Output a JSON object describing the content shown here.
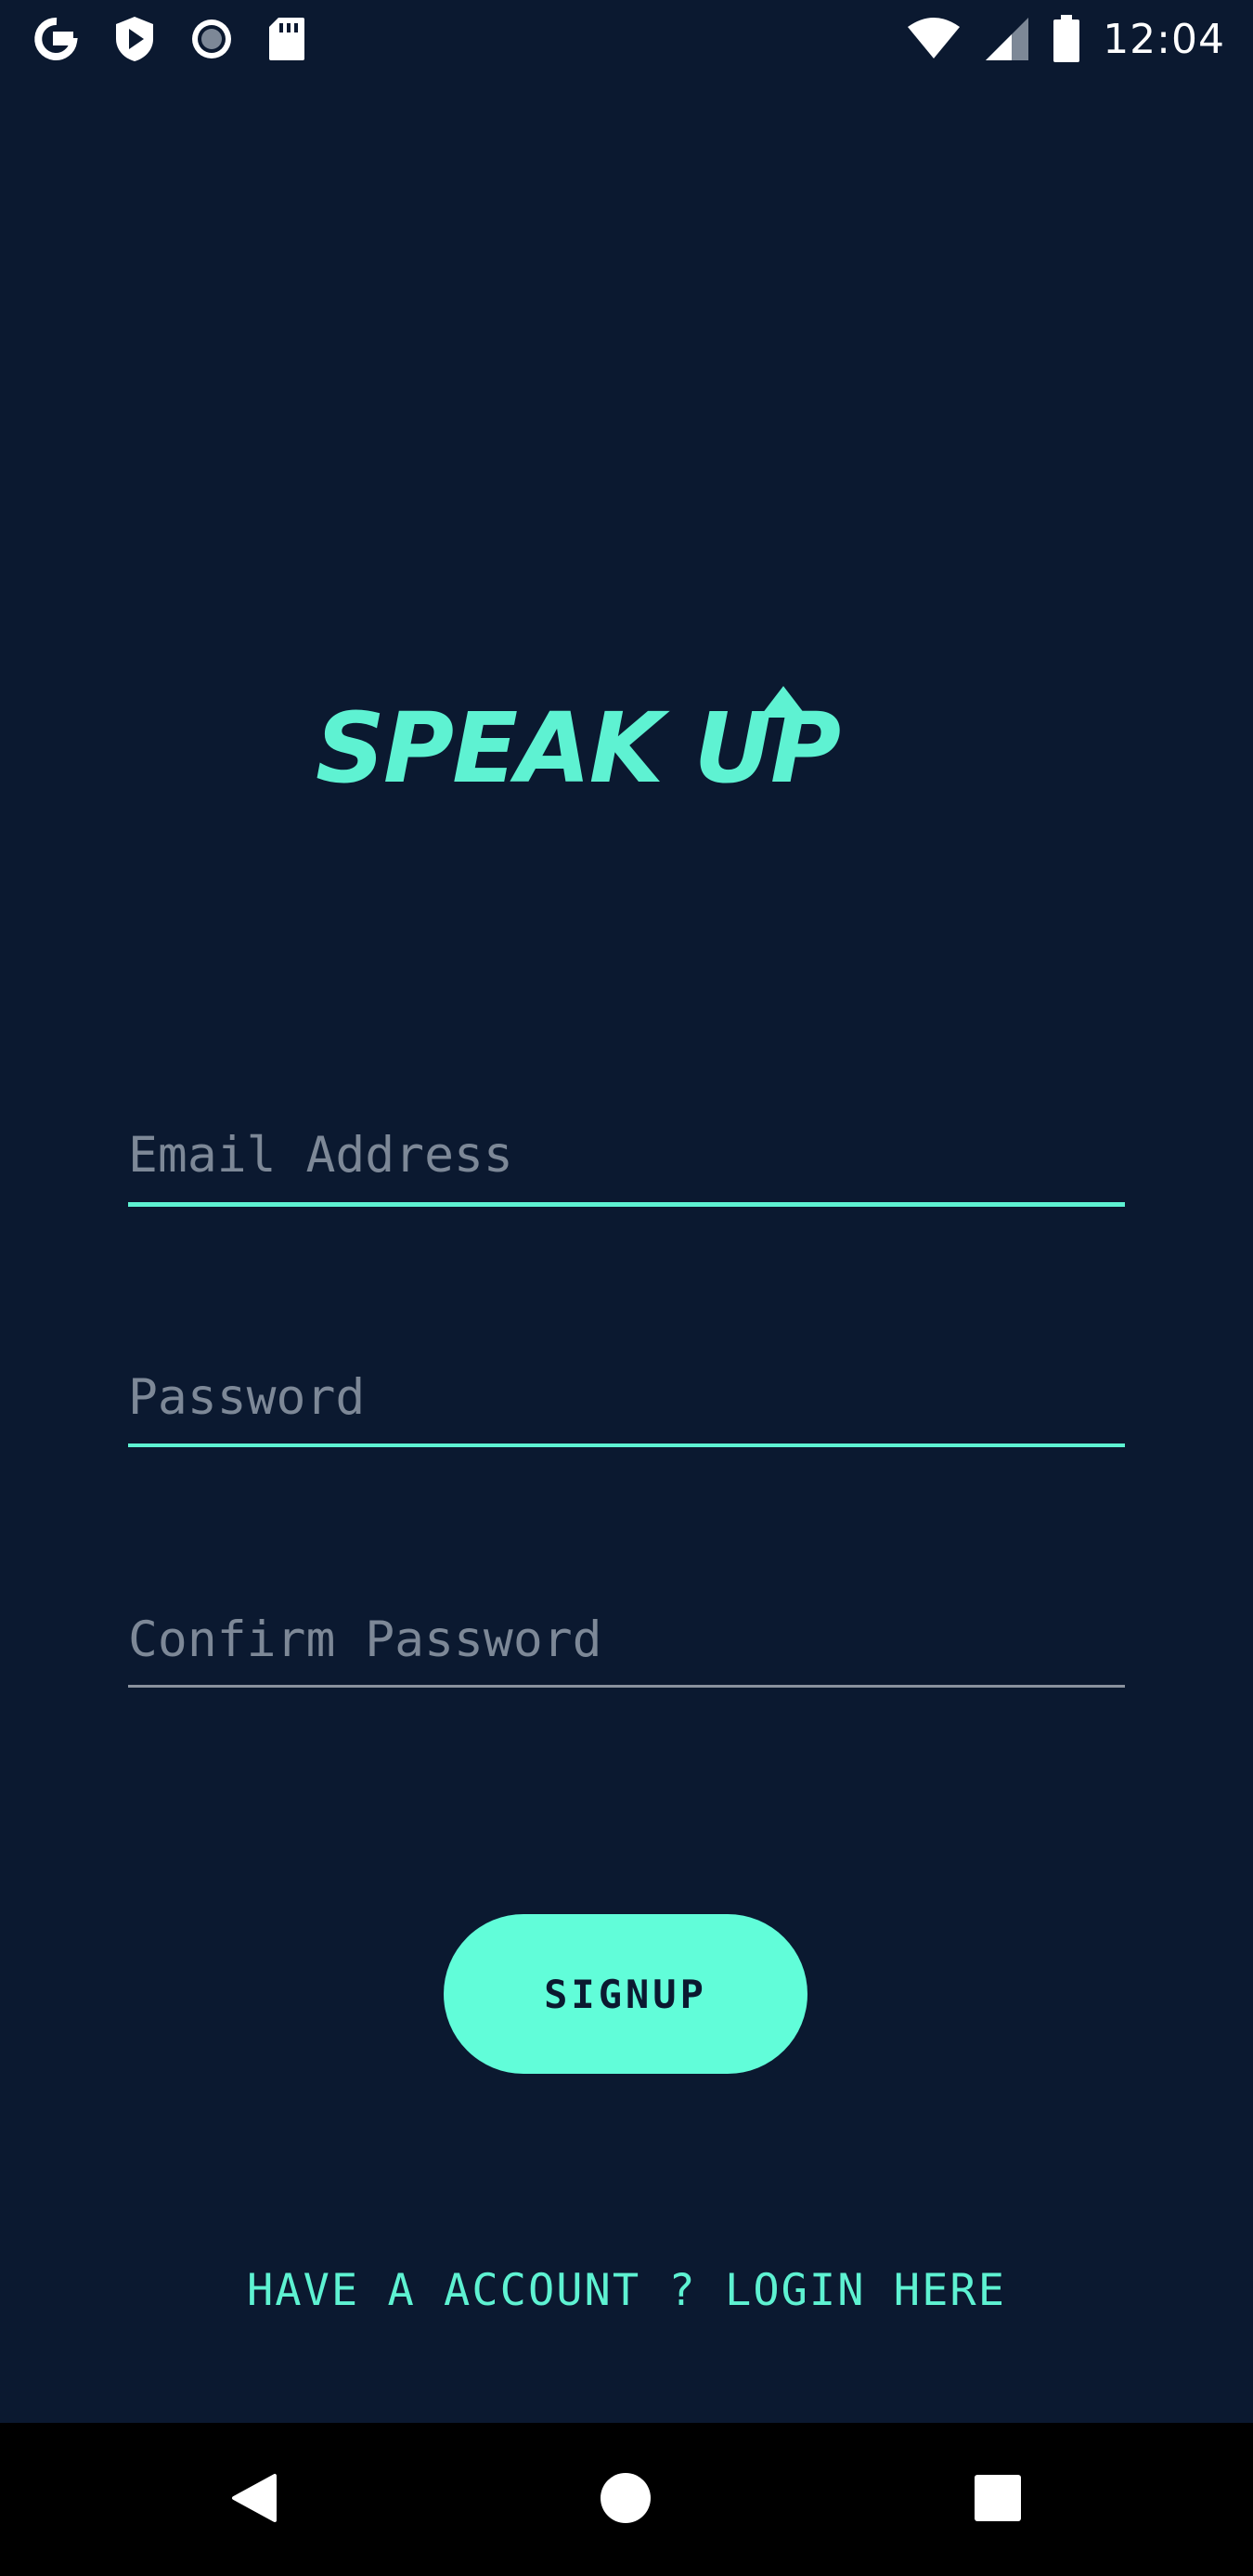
{
  "status_bar": {
    "time": "12:04",
    "left_icons": [
      "google-icon",
      "play-protect-icon",
      "record-icon",
      "sd-card-icon"
    ],
    "right_icons": [
      "wifi-icon",
      "signal-icon",
      "battery-icon"
    ]
  },
  "logo": {
    "text": "SPEAK UP",
    "color": "#5ef2d2"
  },
  "form": {
    "email_placeholder": "Email Address",
    "email_value": "",
    "password_placeholder": "Password",
    "password_value": "",
    "confirm_placeholder": "Confirm Password",
    "confirm_value": ""
  },
  "signup_button": {
    "label": "SIGNUP"
  },
  "login_link": {
    "label": "HAVE A ACCOUNT ? LOGIN HERE"
  },
  "nav_bar": {
    "icons": [
      "back-icon",
      "home-icon",
      "recent-apps-icon"
    ]
  },
  "colors": {
    "background": "#0b1930",
    "accent": "#5ef2d2",
    "button": "#61fdd9",
    "placeholder": "#7d8897"
  }
}
